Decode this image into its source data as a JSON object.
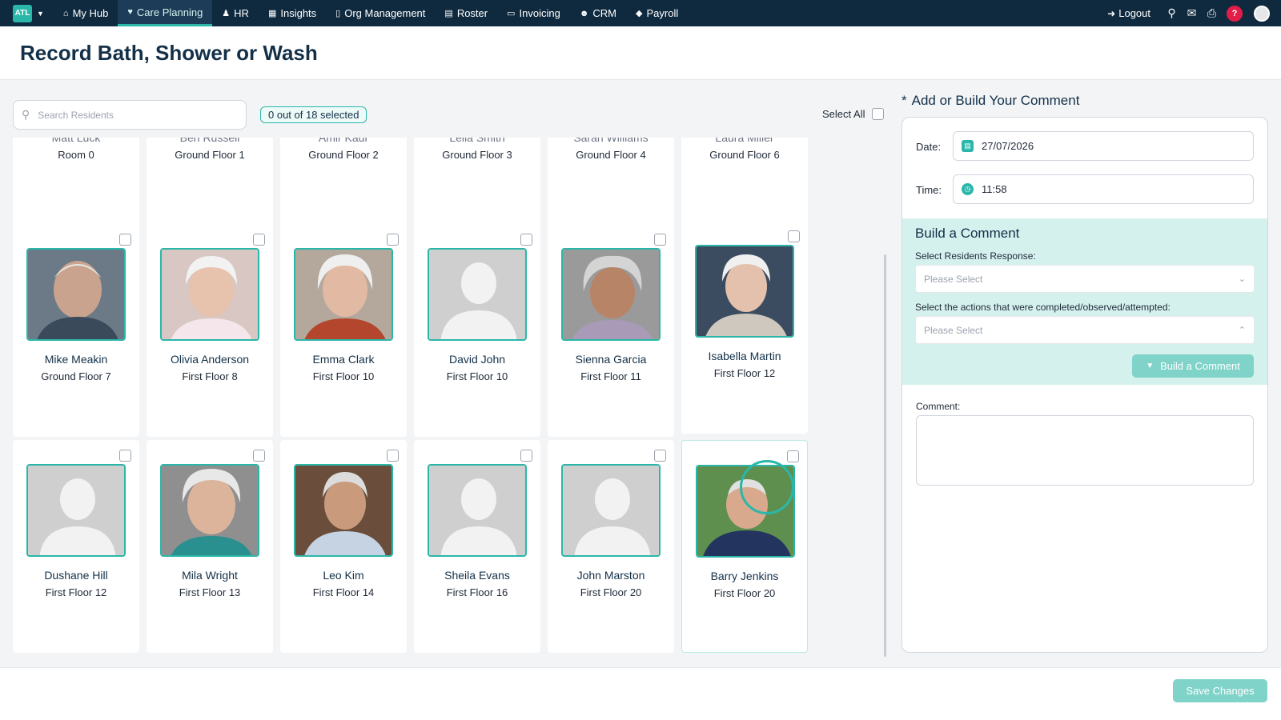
{
  "nav": {
    "brand": "ATL",
    "items": [
      {
        "label": "My Hub",
        "icon": "home-icon",
        "active": false
      },
      {
        "label": "Care Planning",
        "icon": "heart-icon",
        "active": true
      },
      {
        "label": "HR",
        "icon": "users-icon",
        "active": false
      },
      {
        "label": "Insights",
        "icon": "chart-icon",
        "active": false
      },
      {
        "label": "Org Management",
        "icon": "building-icon",
        "active": false
      },
      {
        "label": "Roster",
        "icon": "calendar-icon",
        "active": false
      },
      {
        "label": "Invoicing",
        "icon": "file-icon",
        "active": false
      },
      {
        "label": "CRM",
        "icon": "user-gear-icon",
        "active": false
      },
      {
        "label": "Payroll",
        "icon": "money-icon",
        "active": false
      }
    ],
    "logout_label": "Logout",
    "help_label": "?"
  },
  "page": {
    "title": "Record Bath, Shower or Wash"
  },
  "toolbar": {
    "search_placeholder": "Search Residents",
    "selected_count": "0 out of 18 selected",
    "select_all_label": "Select All"
  },
  "residents_top_row": [
    {
      "name": "Matt Luck",
      "room": "Room 0"
    },
    {
      "name": "Ben Russell",
      "room": "Ground Floor 1"
    },
    {
      "name": "Amir Kaur",
      "room": "Ground Floor 2"
    },
    {
      "name": "Leila Smith",
      "room": "Ground Floor 3"
    },
    {
      "name": "Sarah Williams",
      "room": "Ground Floor 4"
    },
    {
      "name": "Laura Miller",
      "room": "Ground Floor 6"
    }
  ],
  "residents": [
    {
      "name": "Mike Meakin",
      "room": "Ground Floor 7",
      "photo": "person-photo"
    },
    {
      "name": "Olivia Anderson",
      "room": "First Floor 8",
      "photo": "person-photo"
    },
    {
      "name": "Emma Clark",
      "room": "First Floor 10",
      "photo": "person-photo"
    },
    {
      "name": "David John",
      "room": "First Floor 10",
      "photo": "placeholder-avatar"
    },
    {
      "name": "Sienna Garcia",
      "room": "First Floor 11",
      "photo": "person-photo"
    },
    {
      "name": "Isabella Martin",
      "room": "First Floor 12",
      "photo": "person-photo"
    },
    {
      "name": "Dushane Hill",
      "room": "First Floor 12",
      "photo": "placeholder-avatar"
    },
    {
      "name": "Mila Wright",
      "room": "First Floor 13",
      "photo": "person-photo"
    },
    {
      "name": "Leo Kim",
      "room": "First Floor 14",
      "photo": "person-photo"
    },
    {
      "name": "Sheila Evans",
      "room": "First Floor 16",
      "photo": "placeholder-avatar"
    },
    {
      "name": "John Marston",
      "room": "First Floor 20",
      "photo": "placeholder-avatar"
    },
    {
      "name": "Barry Jenkins",
      "room": "First Floor 20",
      "photo": "person-photo"
    }
  ],
  "panel": {
    "title": "Add or Build Your Comment",
    "required_marker": "*",
    "date_label": "Date:",
    "date_value": "27/07/2026",
    "time_label": "Time:",
    "time_value": "11:58",
    "build_title": "Build a Comment",
    "response_label": "Select Residents Response:",
    "response_placeholder": "Please Select",
    "actions_label": "Select the actions that were completed/observed/attempted:",
    "actions_placeholder": "Please Select",
    "build_button": "Build a Comment",
    "comment_label": "Comment:"
  },
  "footer": {
    "save_label": "Save Changes"
  },
  "colors": {
    "nav_bg": "#0f2a3f",
    "accent": "#2ab7a9",
    "accent_light": "#d5f1ee",
    "button_disabled": "#7fd3c9"
  }
}
